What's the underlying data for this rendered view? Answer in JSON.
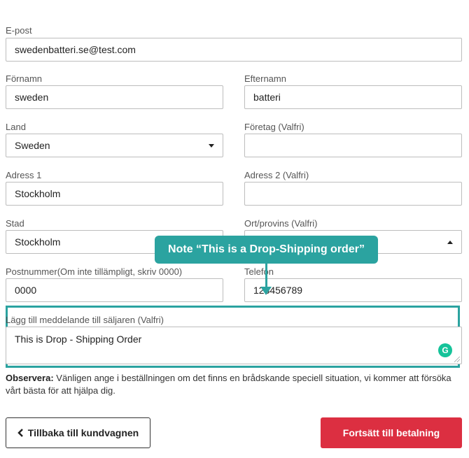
{
  "form": {
    "email": {
      "label": "E-post",
      "value": "swedenbatteri.se@test.com"
    },
    "first_name": {
      "label": "Förnamn",
      "value": "sweden"
    },
    "last_name": {
      "label": "Efternamn",
      "value": "batteri"
    },
    "country": {
      "label": "Land",
      "value": "Sweden"
    },
    "company": {
      "label": "Företag (Valfri)",
      "value": ""
    },
    "address1": {
      "label": "Adress 1",
      "value": "Stockholm"
    },
    "address2": {
      "label": "Adress 2 (Valfri)",
      "value": ""
    },
    "city": {
      "label": "Stad",
      "value": "Stockholm"
    },
    "province": {
      "label": "Ort/provins (Valfri)",
      "value": ""
    },
    "postcode": {
      "label": "Postnummer(Om inte tillämpligt, skriv 0000)",
      "value": "0000"
    },
    "phone": {
      "label": "Telefon",
      "value": "123456789"
    },
    "message": {
      "label": "Lägg till meddelande till säljaren (Valfri)",
      "value": "This is Drop - Shipping Order"
    }
  },
  "grammar_icon_glyph": "G",
  "callout": {
    "text": "Note “This is a Drop-Shipping order”",
    "color": "#2ba3a0"
  },
  "note": {
    "label": "Observera:",
    "text": " Vänligen ange i beställningen om det finns en brådskande speciell situation, vi kommer att försöka vårt bästa för att hjälpa dig."
  },
  "buttons": {
    "back_label": "Tillbaka till kundvagnen",
    "back_icon": "chevron-left-icon",
    "continue_label": "Fortsätt till betalning",
    "continue_color": "#dc2f41"
  }
}
